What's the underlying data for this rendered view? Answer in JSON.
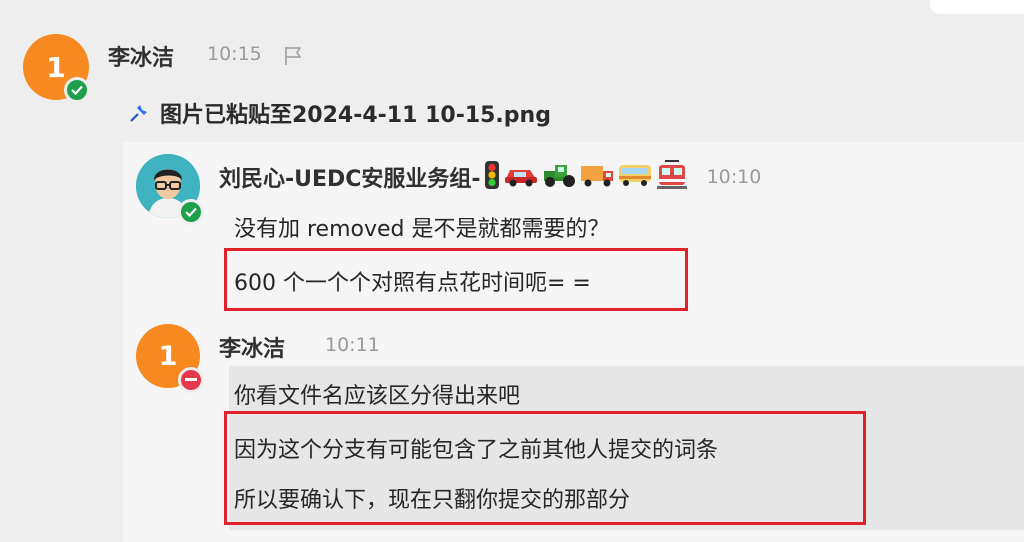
{
  "message1": {
    "avatar_initial": "1",
    "sender": "李冰洁",
    "time": "10:15",
    "flag_icon": "flag-icon",
    "attachment_icon": "pin-icon",
    "attachment_text": "图片已粘贴至2024-4-11 10-15.png"
  },
  "quoted": {
    "msg_a": {
      "sender": "刘民心-UEDC安服业务组-",
      "emoji_icons": [
        "traffic-light-icon",
        "car-icon",
        "tractor-icon",
        "truck-icon",
        "bus-icon",
        "tram-icon"
      ],
      "time": "10:10",
      "lines": [
        "没有加 removed 是不是就都需要的？",
        "600 个一个个对照有点花时间呃= ="
      ]
    },
    "msg_b": {
      "avatar_initial": "1",
      "sender": "李冰洁",
      "time": "10:11",
      "lines": [
        "你看文件名应该区分得出来吧",
        "因为这个分支有可能包含了之前其他人提交的词条",
        "所以要确认下，现在只翻你提交的那部分"
      ]
    }
  },
  "colors": {
    "avatar_orange": "#f6891f",
    "status_green": "#1e9f4a",
    "status_red": "#e6374c",
    "highlight_red": "#e0202b",
    "pin_blue": "#2f6fe8"
  }
}
